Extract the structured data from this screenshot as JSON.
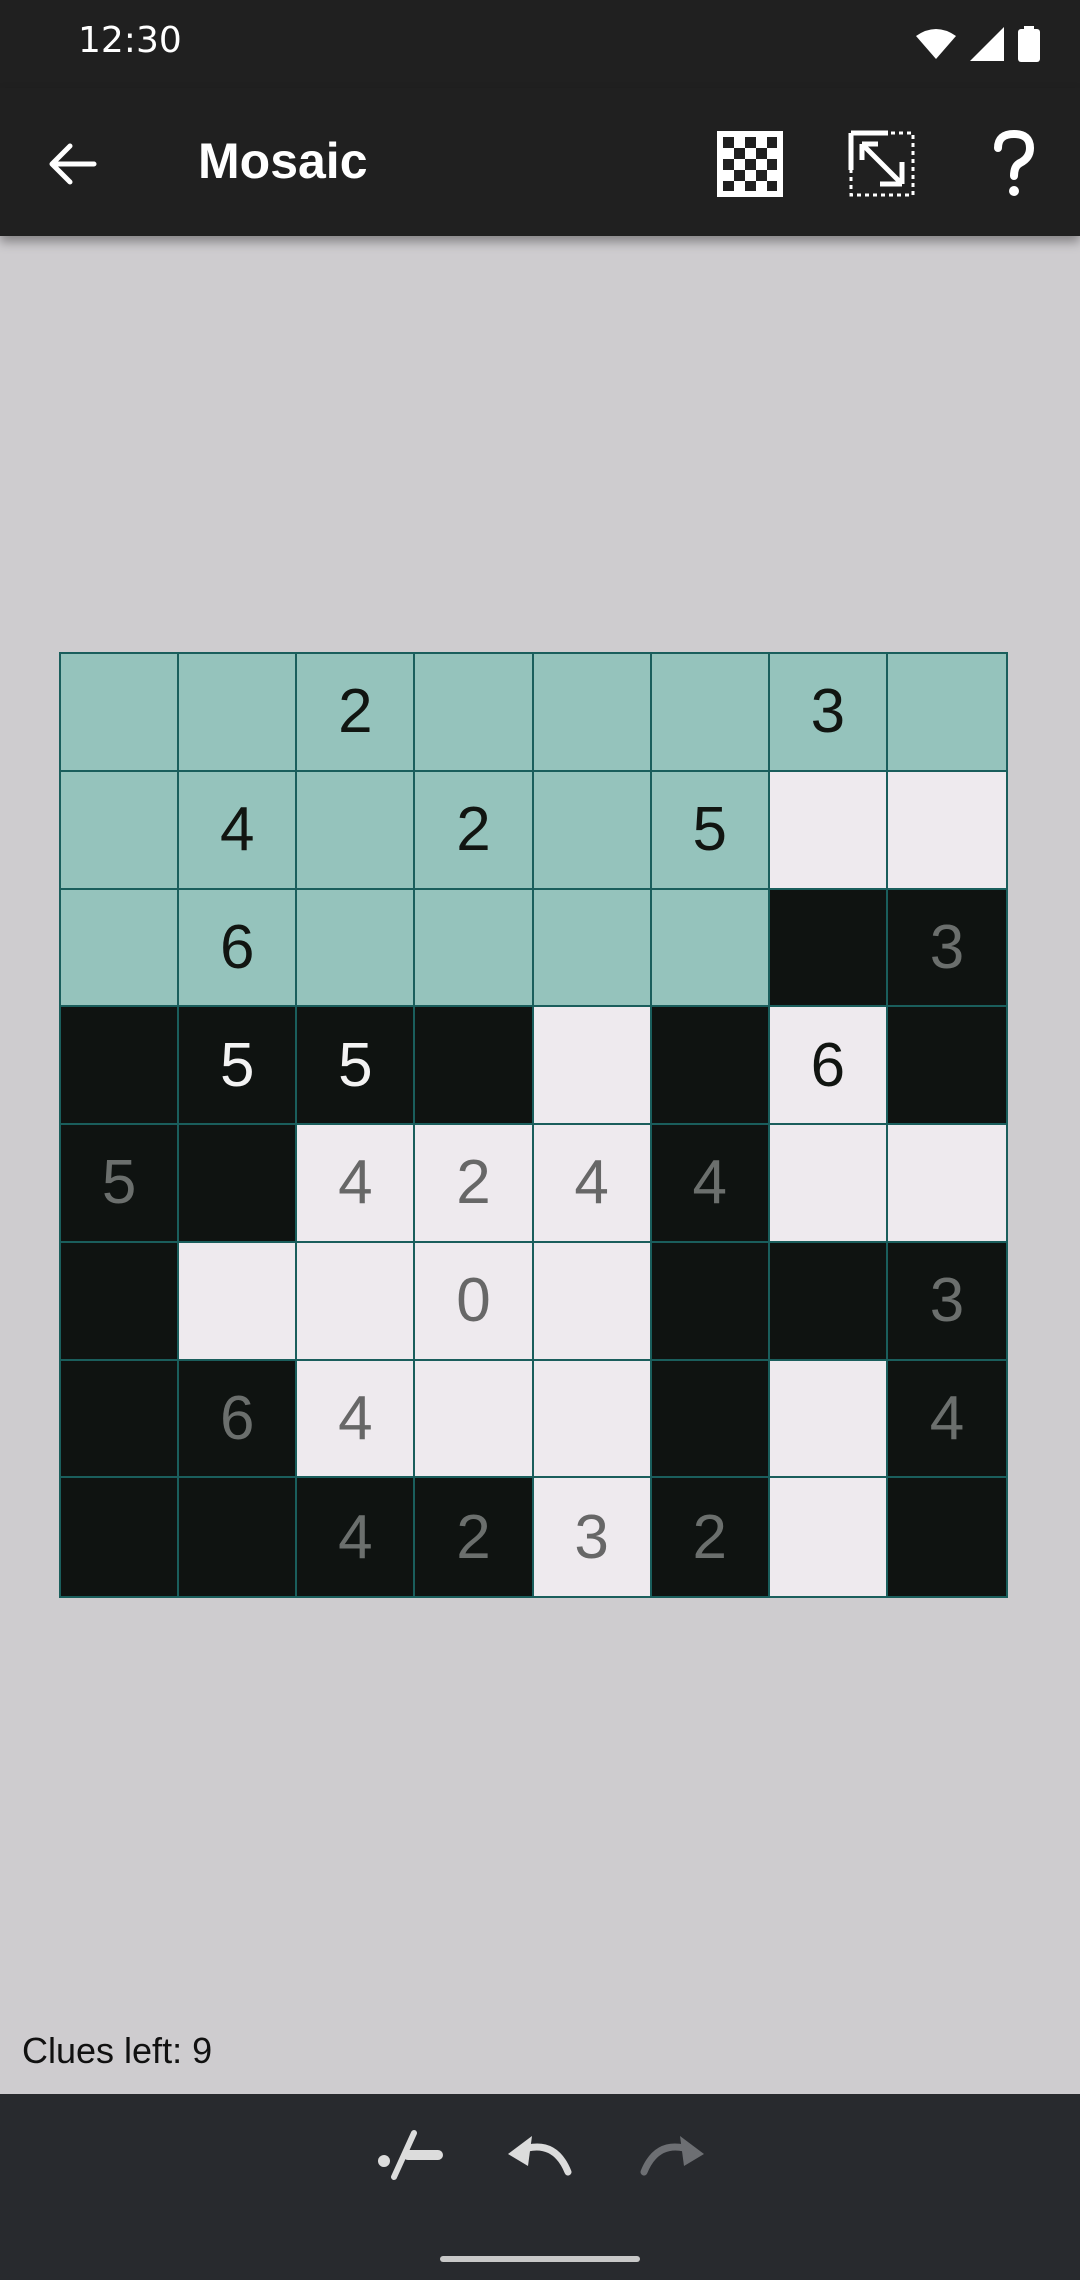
{
  "status_bar": {
    "time": "12:30"
  },
  "app_bar": {
    "title": "Mosaic",
    "icons": [
      "back-arrow-icon",
      "checkerboard-icon",
      "resize-diagonal-icon",
      "help-icon"
    ]
  },
  "board": {
    "rows": 8,
    "cols": 8,
    "colors": {
      "unknown": "#95c3bc",
      "empty": "#eeeaee",
      "filled": "#0f1311",
      "grid": "#1a5e5c"
    },
    "cells": [
      [
        {
          "s": "unknown",
          "n": ""
        },
        {
          "s": "unknown",
          "n": ""
        },
        {
          "s": "unknown",
          "n": "2"
        },
        {
          "s": "unknown",
          "n": ""
        },
        {
          "s": "unknown",
          "n": ""
        },
        {
          "s": "unknown",
          "n": ""
        },
        {
          "s": "unknown",
          "n": "3"
        },
        {
          "s": "unknown",
          "n": ""
        }
      ],
      [
        {
          "s": "unknown",
          "n": ""
        },
        {
          "s": "unknown",
          "n": "4"
        },
        {
          "s": "unknown",
          "n": ""
        },
        {
          "s": "unknown",
          "n": "2"
        },
        {
          "s": "unknown",
          "n": ""
        },
        {
          "s": "unknown",
          "n": "5"
        },
        {
          "s": "empty",
          "n": ""
        },
        {
          "s": "empty",
          "n": ""
        }
      ],
      [
        {
          "s": "unknown",
          "n": ""
        },
        {
          "s": "unknown",
          "n": "6"
        },
        {
          "s": "unknown",
          "n": ""
        },
        {
          "s": "unknown",
          "n": ""
        },
        {
          "s": "unknown",
          "n": ""
        },
        {
          "s": "unknown",
          "n": ""
        },
        {
          "s": "filled",
          "n": ""
        },
        {
          "s": "filled",
          "n": "3",
          "d": true
        }
      ],
      [
        {
          "s": "filled",
          "n": ""
        },
        {
          "s": "filled",
          "n": "5"
        },
        {
          "s": "filled",
          "n": "5"
        },
        {
          "s": "filled",
          "n": ""
        },
        {
          "s": "empty",
          "n": ""
        },
        {
          "s": "filled",
          "n": ""
        },
        {
          "s": "empty",
          "n": "6"
        },
        {
          "s": "filled",
          "n": ""
        }
      ],
      [
        {
          "s": "filled",
          "n": "5",
          "d": true
        },
        {
          "s": "filled",
          "n": ""
        },
        {
          "s": "empty",
          "n": "4",
          "d": true
        },
        {
          "s": "empty",
          "n": "2",
          "d": true
        },
        {
          "s": "empty",
          "n": "4",
          "d": true
        },
        {
          "s": "filled",
          "n": "4",
          "d": true
        },
        {
          "s": "empty",
          "n": ""
        },
        {
          "s": "empty",
          "n": ""
        }
      ],
      [
        {
          "s": "filled",
          "n": ""
        },
        {
          "s": "empty",
          "n": ""
        },
        {
          "s": "empty",
          "n": ""
        },
        {
          "s": "empty",
          "n": "0",
          "d": true
        },
        {
          "s": "empty",
          "n": ""
        },
        {
          "s": "filled",
          "n": ""
        },
        {
          "s": "filled",
          "n": ""
        },
        {
          "s": "filled",
          "n": "3",
          "d": true
        }
      ],
      [
        {
          "s": "filled",
          "n": ""
        },
        {
          "s": "filled",
          "n": "6",
          "d": true
        },
        {
          "s": "empty",
          "n": "4",
          "d": true
        },
        {
          "s": "empty",
          "n": ""
        },
        {
          "s": "empty",
          "n": ""
        },
        {
          "s": "filled",
          "n": ""
        },
        {
          "s": "empty",
          "n": ""
        },
        {
          "s": "filled",
          "n": "4",
          "d": true
        }
      ],
      [
        {
          "s": "filled",
          "n": ""
        },
        {
          "s": "filled",
          "n": ""
        },
        {
          "s": "filled",
          "n": "4",
          "d": true
        },
        {
          "s": "filled",
          "n": "2",
          "d": true
        },
        {
          "s": "empty",
          "n": "3",
          "d": true
        },
        {
          "s": "filled",
          "n": "2",
          "d": true
        },
        {
          "s": "empty",
          "n": ""
        },
        {
          "s": "filled",
          "n": ""
        }
      ]
    ]
  },
  "footer": {
    "clues_left": "Clues left: 9",
    "icons": [
      "toggle-mark-icon",
      "undo-icon",
      "redo-icon"
    ]
  }
}
